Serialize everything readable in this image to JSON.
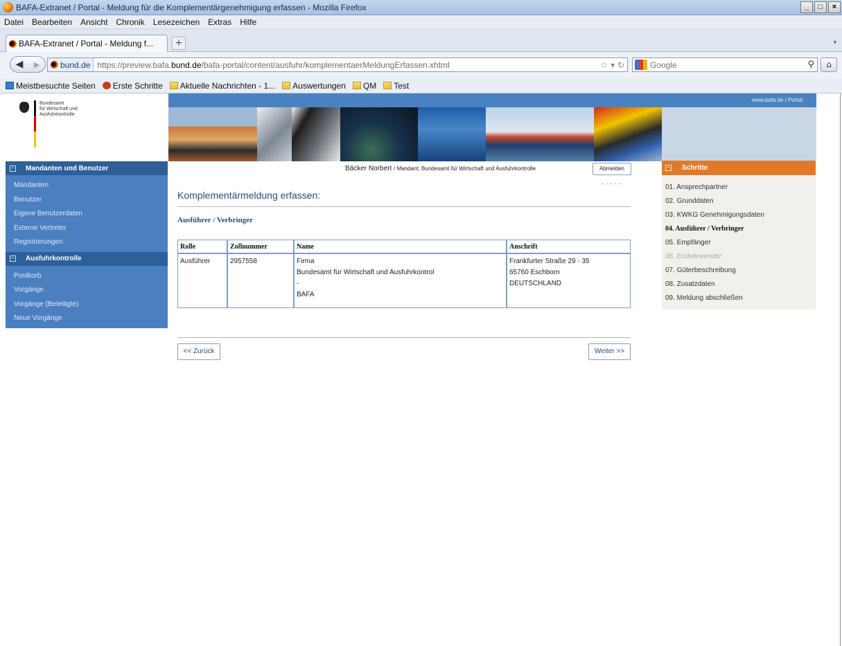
{
  "window": {
    "title": "BAFA-Extranet / Portal - Meldung für die Komplementärgenehmigung erfassen - Mozilla Firefox",
    "buttons": {
      "minimize": "_",
      "maximize": "□",
      "close": "×"
    }
  },
  "menu": [
    "Datei",
    "Bearbeiten",
    "Ansicht",
    "Chronik",
    "Lesezeichen",
    "Extras",
    "Hilfe"
  ],
  "tab": {
    "label": "BAFA-Extranet / Portal - Meldung f...",
    "new_tab": "+"
  },
  "navbar": {
    "domain": "bund.de",
    "url_prefix": "https://preview.bafa.",
    "url_highlight": "bund.de",
    "url_suffix": "/bafa-portal/content/ausfuhr/komplementaerMeldungErfassen.xhtml",
    "search_placeholder": "Google"
  },
  "bookmarks": [
    {
      "label": "Meistbesuchte Seiten",
      "icon": "bookmark-blue-icon"
    },
    {
      "label": "Erste Schritte",
      "icon": "firefox-red-icon"
    },
    {
      "label": "Aktuelle Nachrichten - 1...",
      "icon": "rss-folder-icon"
    },
    {
      "label": "Auswertungen",
      "icon": "folder-icon"
    },
    {
      "label": "QM",
      "icon": "folder-icon"
    },
    {
      "label": "Test",
      "icon": "folder-icon"
    }
  ],
  "header": {
    "top_links": "www.bafa.de | Portal",
    "logo_lines": [
      "Bundesamt",
      "für Wirtschaft und",
      "Ausfuhrkontrolle"
    ]
  },
  "sidebar": {
    "section1": {
      "title": "Mandanten und Benutzer",
      "items": [
        "Mandanten",
        "Benutzer",
        "Eigene Benutzerdaten",
        "Externe Vertreter",
        "Registrierungen"
      ]
    },
    "section2": {
      "title": "Ausfuhrkontrolle",
      "items": [
        "Postkorb",
        "Vorgänge",
        "Vorgänge (Beteiligte)",
        "Neue Vorgänge"
      ]
    }
  },
  "user": {
    "name": "Bäcker Norbert",
    "mandant": "/ Mandant: Bundesamt für Wirtschaft und Ausfuhrkontrolle",
    "logout": "Abmelden",
    "dots": "•••••"
  },
  "main": {
    "title": "Komplementärmeldung erfassen:",
    "section": "Ausführer / Verbringer",
    "table": {
      "headers": [
        "Rolle",
        "Zollnummer",
        "Name",
        "Anschrift"
      ],
      "row": {
        "rolle": "Ausführer",
        "zollnummer": "2957558",
        "name_lines": [
          "Firma",
          "Bundesamt für Wirtschaft und Ausfuhrkontrol",
          "-",
          "BAFA"
        ],
        "anschrift_lines": [
          "Frankfurter Straße 29 - 35",
          "65760 Eschborn",
          "DEUTSCHLAND"
        ]
      }
    },
    "back_button": "<< Zurück",
    "next_button": "Weiter >>"
  },
  "steps": {
    "title": "Schritte",
    "items": [
      {
        "label": "01.  Ansprechpartner",
        "state": "normal"
      },
      {
        "label": "02.  Grunddaten",
        "state": "normal"
      },
      {
        "label": "03.  KWKG Genehmigungsdaten",
        "state": "normal"
      },
      {
        "label": "04.  Ausführer / Verbringer",
        "state": "active"
      },
      {
        "label": "05.  Empfänger",
        "state": "normal"
      },
      {
        "label": "06.  Endverwender",
        "state": "disabled"
      },
      {
        "label": "07.  Güterbeschreibung",
        "state": "normal"
      },
      {
        "label": "08.  Zusatzdaten",
        "state": "normal"
      },
      {
        "label": "09.  Meldung abschließen",
        "state": "normal"
      }
    ]
  },
  "colors": {
    "nav_blue": "#4a7fc0",
    "nav_head": "#2d5f98",
    "steps_orange": "#e07a28",
    "title_blue": "#2a4b7a"
  }
}
